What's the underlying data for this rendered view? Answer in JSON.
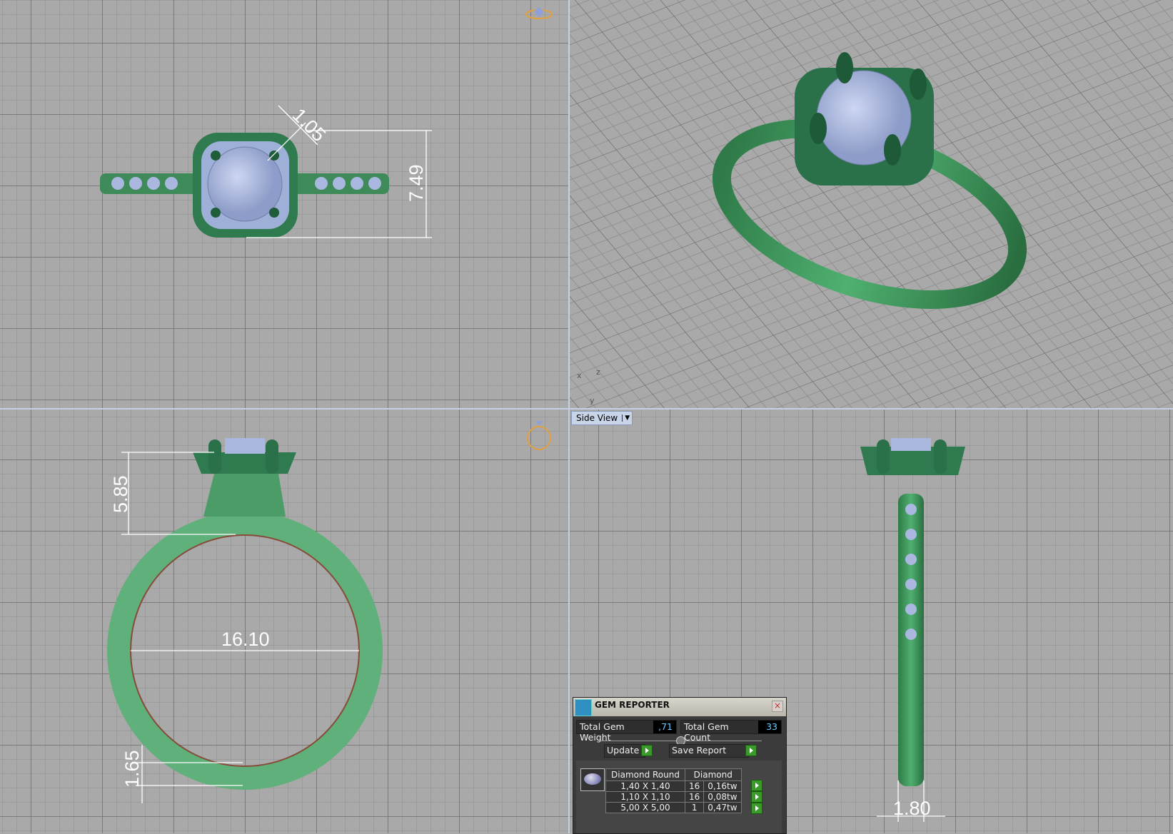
{
  "viewports": {
    "top_view": {
      "dimensions": [
        "1.05",
        "7.49"
      ]
    },
    "perspective_view": {
      "axes": [
        "x",
        "z",
        "y"
      ]
    },
    "front_view": {
      "dimensions": [
        "5.85",
        "16.10",
        "1.65"
      ]
    },
    "side_view": {
      "label": "Side View",
      "dimensions": [
        "1.80"
      ]
    }
  },
  "colors": {
    "metal": "#3e9a5c",
    "gem": "#aab8e0",
    "grid_bg": "#a9a9a9",
    "panel": "#3b3b3b",
    "value": "#66ccff"
  },
  "gem_reporter": {
    "title": "GEM REPORTER",
    "total_weight_label": "Total Gem Weight",
    "total_weight": ",71",
    "total_count_label": "Total Gem Count",
    "total_count": "33",
    "update_label": "Update",
    "save_label": "Save Report",
    "table": {
      "headers": [
        "Diamond Round",
        "Diamond"
      ],
      "rows": [
        {
          "size": "1,40 X 1,40",
          "count": "16",
          "weight": "0,16tw"
        },
        {
          "size": "1,10 X 1,10",
          "count": "16",
          "weight": "0,08tw"
        },
        {
          "size": "5,00 X 5,00",
          "count": "1",
          "weight": "0,47tw"
        }
      ]
    }
  }
}
